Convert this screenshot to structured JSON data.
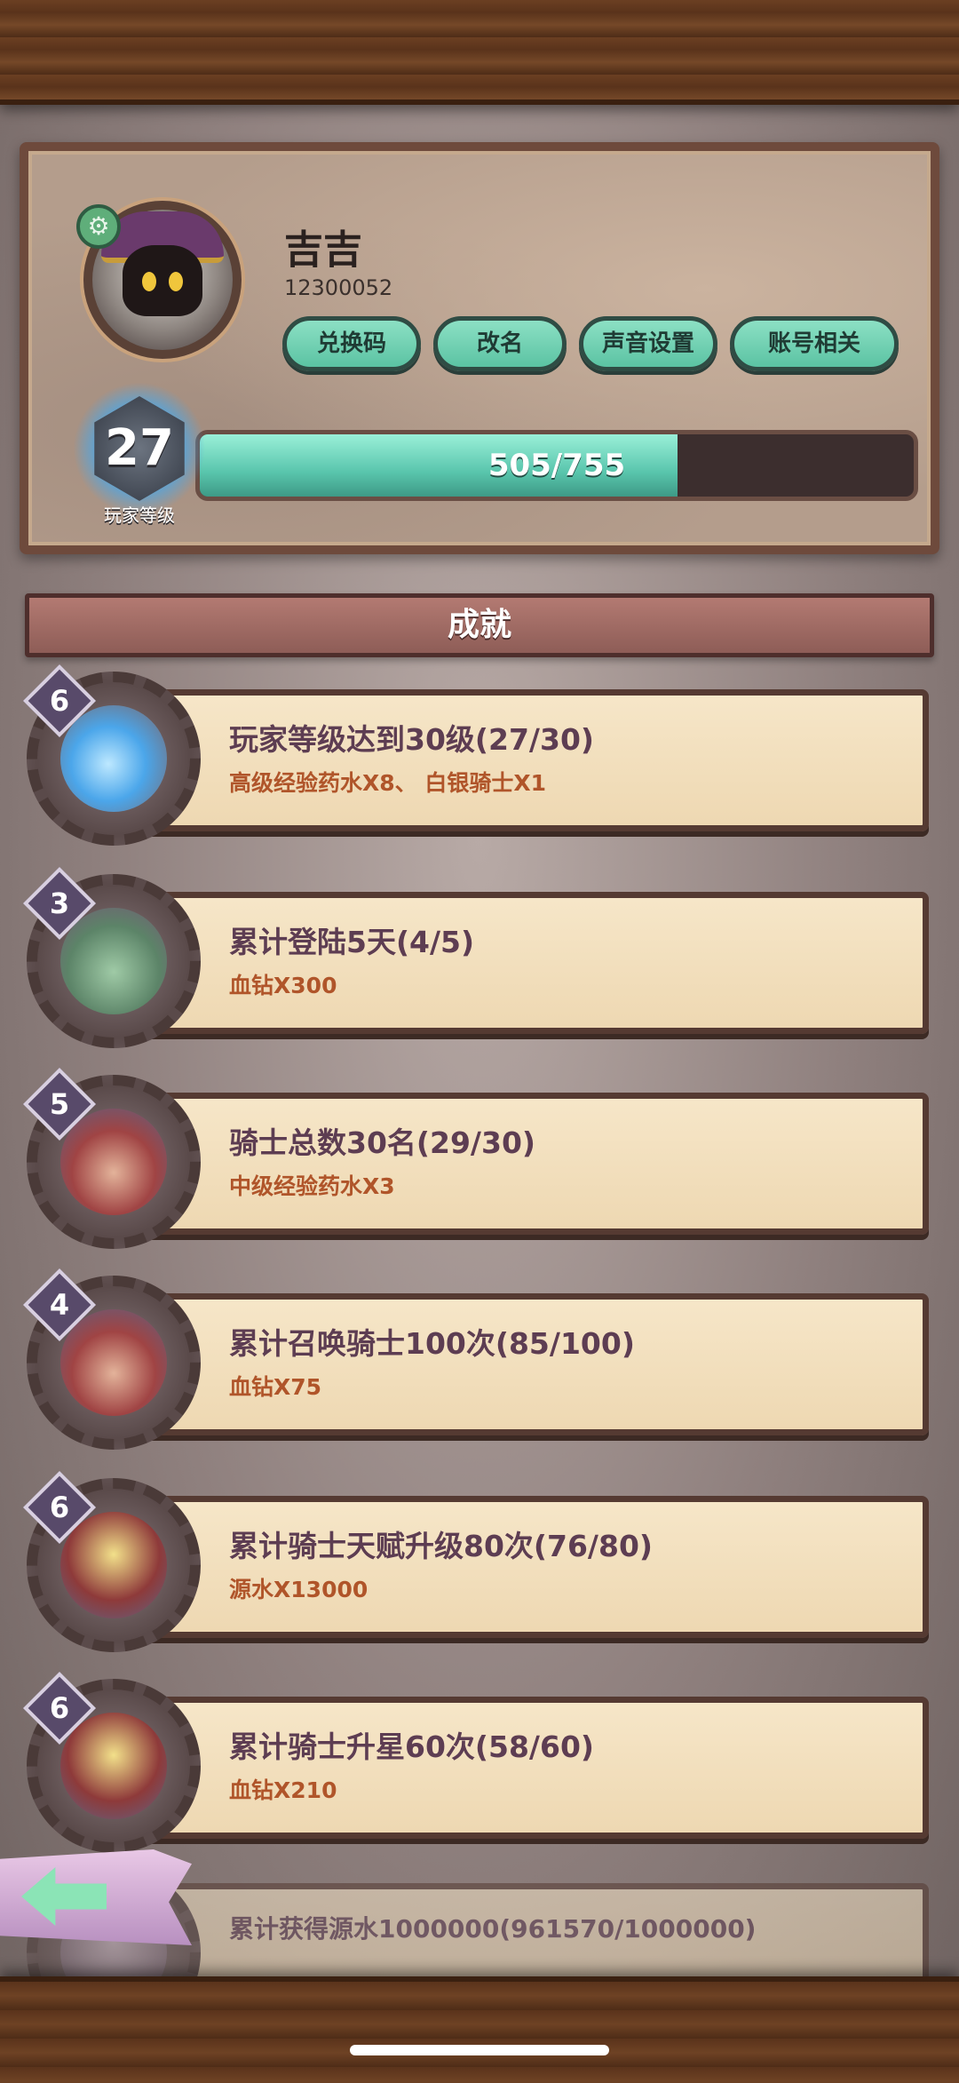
{
  "profile": {
    "name": "吉吉",
    "id": "12300052",
    "buttons": {
      "redeem": "兑换码",
      "rename": "改名",
      "sound": "声音设置",
      "account": "账号相关"
    },
    "level": "27",
    "level_label": "玩家等级",
    "xp_text": "505/755",
    "xp_fraction": 0.669
  },
  "section_title": "成就",
  "achievements": [
    {
      "badge": "6",
      "title": "玩家等级达到30级(27/30)",
      "reward": "高级经验药水X8、 白银骑士X1",
      "icon": "blue-flame-icon"
    },
    {
      "badge": "3",
      "title": "累计登陆5天(4/5)",
      "reward": "血钻X300",
      "icon": "gear-crown-icon"
    },
    {
      "badge": "5",
      "title": "骑士总数30名(29/30)",
      "reward": "中级经验药水X3",
      "icon": "knights-group-icon"
    },
    {
      "badge": "4",
      "title": "累计召唤骑士100次(85/100)",
      "reward": "血钻X75",
      "icon": "knights-summon-icon"
    },
    {
      "badge": "6",
      "title": "累计骑士天赋升级80次(76/80)",
      "reward": "源水X13000",
      "icon": "hat-knight-icon"
    },
    {
      "badge": "6",
      "title": "累计骑士升星60次(58/60)",
      "reward": "血钻X210",
      "icon": "hat-knight-icon"
    },
    {
      "badge": "",
      "title": "累计获得源水1000000(961570/1000000)",
      "reward": "",
      "icon": "water-icon"
    }
  ],
  "icons": {
    "settings": "gear-icon",
    "back": "left-arrow-icon"
  },
  "colors": {
    "accent_green": "#5bc3a3",
    "title_purple": "#5d3d52",
    "reward_orange": "#b0552a"
  }
}
